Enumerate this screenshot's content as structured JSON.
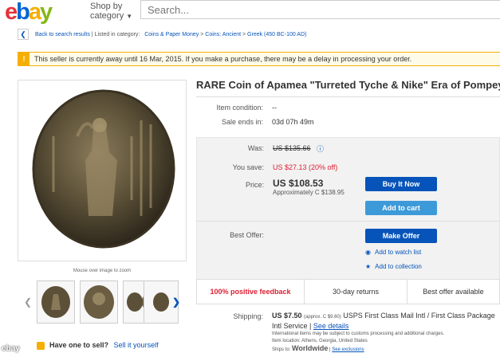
{
  "header": {
    "logo": [
      "e",
      "b",
      "a",
      "y"
    ],
    "shop_by_line1": "Shop by",
    "shop_by_line2": "category",
    "search_placeholder": "Search..."
  },
  "breadcrumb": {
    "back": "Back to search results",
    "listed": "Listed in category:",
    "items": [
      "Coins & Paper Money",
      "Coins: Ancient",
      "Greek (450 BC-100 AD)"
    ],
    "sep": ">"
  },
  "notice": {
    "text": "This seller is currently away until 16 Mar, 2015. If you make a purchase, there may be a delay in processing your order."
  },
  "item": {
    "title": "RARE Coin of Apamea \"Turreted Tyche & Nike\" Era of Pompey",
    "condition_label": "Item condition:",
    "condition_value": "--",
    "sale_ends_label": "Sale ends in:",
    "sale_ends_value": "03d 07h 49m"
  },
  "pricing": {
    "was_label": "Was:",
    "was_value": "US $135.66",
    "save_label": "You save:",
    "save_value": "US $27.13 (20% off)",
    "price_label": "Price:",
    "price_value": "US $108.53",
    "approx": "Approximately C $138.95",
    "buy_now": "Buy It Now",
    "add_to_cart": "Add to cart",
    "best_offer_label": "Best Offer:",
    "make_offer": "Make Offer",
    "watch_list": "Add to watch list",
    "collection": "Add to collection"
  },
  "features": {
    "feedback": "100% positive feedback",
    "returns": "30-day returns",
    "best_offer": "Best offer available"
  },
  "gallery": {
    "hint": "Mouse over image to zoom"
  },
  "shipping": {
    "label": "Shipping:",
    "price": "US $7.50",
    "approx": "(approx. C $9.60)",
    "service": "USPS First Class Mail Intl / First Class Package Intl Service",
    "see_details": "See details",
    "fine": "International items may be subject to customs processing and additional charges.",
    "location": "Item location: Athens, Georgia, United States",
    "ships_to_label": "Ships to:",
    "ships_to_value": "Worldwide",
    "see_exclusions": "See exclusions"
  },
  "sell": {
    "question": "Have one to sell?",
    "link": "Sell it yourself"
  },
  "watermark": "ebay",
  "colors": {
    "ebay_red": "#e53238",
    "ebay_blue": "#0654ba",
    "ebay_yellow": "#f5af02",
    "ebay_green": "#86b817",
    "savings_red": "#dd1e31"
  }
}
